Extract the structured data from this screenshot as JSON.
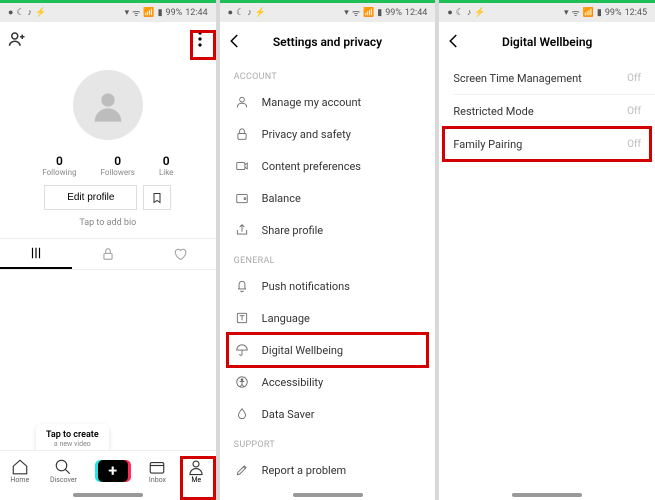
{
  "status": {
    "battery_pct": "99%",
    "time": "12:44",
    "time3": "12:45"
  },
  "screen1": {
    "stats": [
      {
        "num": "0",
        "lbl": "Following"
      },
      {
        "num": "0",
        "lbl": "Followers"
      },
      {
        "num": "0",
        "lbl": "Like"
      }
    ],
    "edit": "Edit profile",
    "bio": "Tap to add bio",
    "promo_title": "Tap to create",
    "promo_sub": "a new video",
    "nav": {
      "home": "Home",
      "discover": "Discover",
      "inbox": "Inbox",
      "me": "Me"
    }
  },
  "screen2": {
    "title": "Settings and privacy",
    "sections": {
      "account": "Account",
      "general": "General",
      "support": "Support"
    },
    "rows": {
      "manage": "Manage my account",
      "privacy": "Privacy and safety",
      "content": "Content preferences",
      "balance": "Balance",
      "share": "Share profile",
      "push": "Push notifications",
      "language": "Language",
      "dw": "Digital Wellbeing",
      "accessibility": "Accessibility",
      "datasaver": "Data Saver",
      "report": "Report a problem"
    }
  },
  "screen3": {
    "title": "Digital Wellbeing",
    "rows": [
      {
        "lbl": "Screen Time Management",
        "val": "Off"
      },
      {
        "lbl": "Restricted Mode",
        "val": "Off"
      },
      {
        "lbl": "Family Pairing",
        "val": "Off"
      }
    ]
  }
}
